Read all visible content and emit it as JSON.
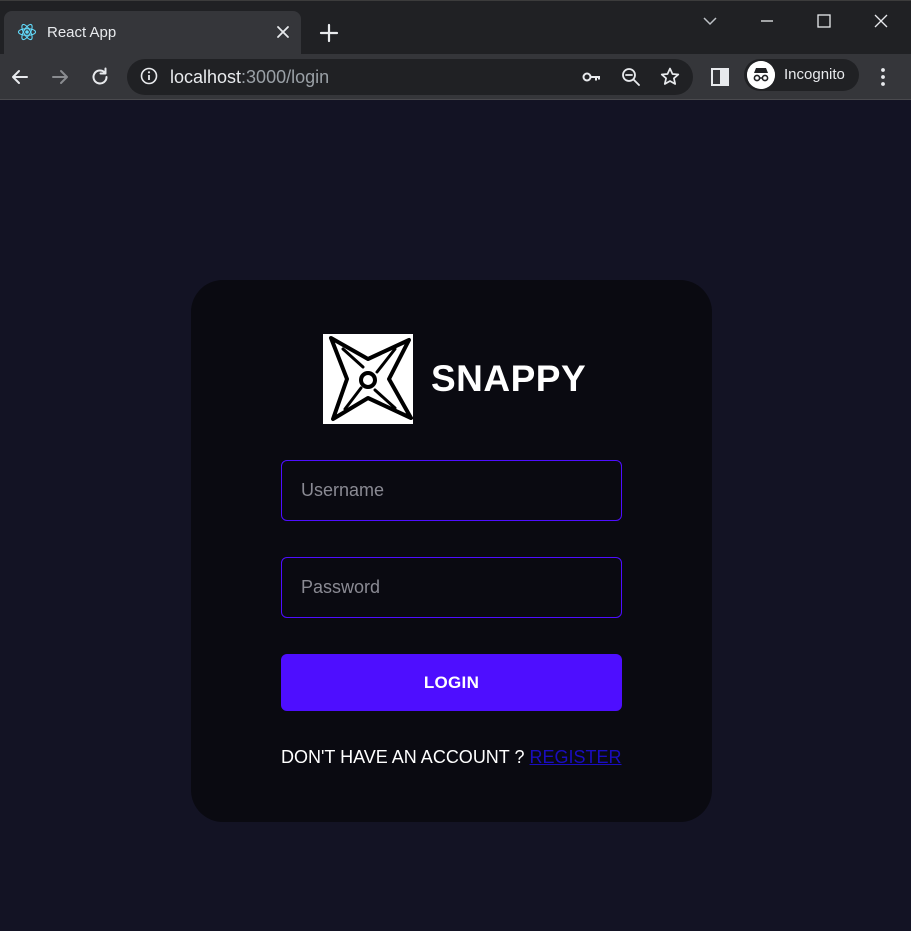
{
  "browser": {
    "tab_title": "React App",
    "url_host": "localhost",
    "url_rest": ":3000/login",
    "incognito_label": "Incognito"
  },
  "brand": {
    "name": "SNAPPY"
  },
  "form": {
    "username_placeholder": "Username",
    "password_placeholder": "Password",
    "username_value": "",
    "password_value": "",
    "login_label": "LOGIN",
    "no_account_text": "DON'T HAVE AN ACCOUNT ?",
    "register_label": "REGISTER"
  },
  "colors": {
    "page_bg": "#131324",
    "card_bg": "#0a0a11",
    "accent": "#4e0eff",
    "link": "#1a0dbf"
  },
  "icons": {
    "favicon": "react-icon",
    "logo": "shuriken-icon"
  }
}
